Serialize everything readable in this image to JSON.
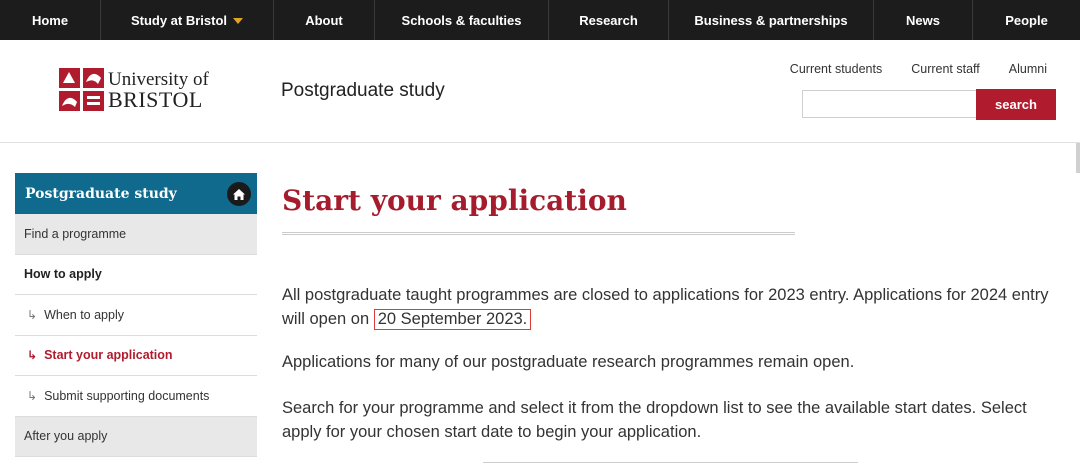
{
  "topnav": [
    {
      "label": "Home",
      "width": 101
    },
    {
      "label": "Study at Bristol",
      "width": 173,
      "dropdown": true
    },
    {
      "label": "About",
      "width": 101
    },
    {
      "label": "Schools & faculties",
      "width": 174
    },
    {
      "label": "Research",
      "width": 120
    },
    {
      "label": "Business & partnerships",
      "width": 205
    },
    {
      "label": "News",
      "width": 99
    },
    {
      "label": "People",
      "width": 107
    }
  ],
  "header": {
    "logo_line1": "University of",
    "logo_line2": "BRISTOL",
    "site_title": "Postgraduate study",
    "util_links": [
      "Current students",
      "Current staff",
      "Alumni"
    ],
    "search_placeholder": "",
    "search_button": "search"
  },
  "sidebar": {
    "heading": "Postgraduate study",
    "items": [
      {
        "label": "Find a programme",
        "style": "grey"
      },
      {
        "label": "How to apply",
        "style": "bold"
      },
      {
        "label": "When to apply",
        "style": "sub"
      },
      {
        "label": "Start your application",
        "style": "sub active"
      },
      {
        "label": "Submit supporting documents",
        "style": "sub"
      },
      {
        "label": "After you apply",
        "style": "grey"
      }
    ]
  },
  "main": {
    "title": "Start your application",
    "p1_before": "All postgraduate taught programmes are closed to applications for 2023 entry. Applications for 2024 entry will open on ",
    "p1_date": "20 September 2023.",
    "p2": "Applications for many of our postgraduate research programmes remain open.",
    "p3": "Search for your programme and select it from the dropdown list to see the available start dates. Select apply for your chosen start date to begin your application."
  },
  "colors": {
    "brand_red": "#b01c2e",
    "nav_bg": "#1c1c1c",
    "sidebar_head": "#0f6a8e",
    "title_red": "#a51d2d"
  }
}
